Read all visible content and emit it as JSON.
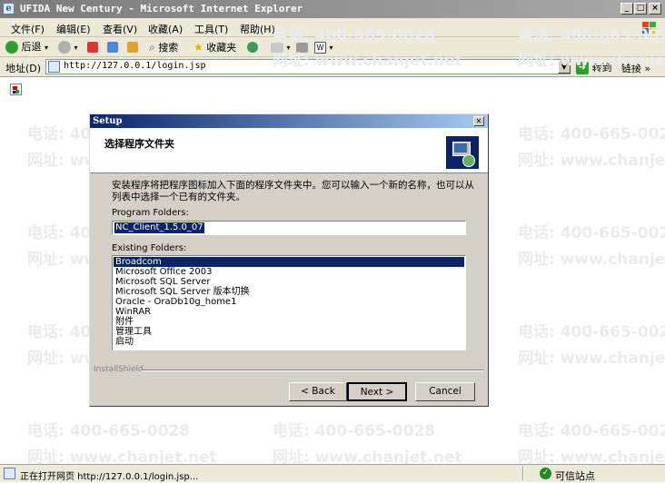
{
  "browser": {
    "title": "UFIDA New Century - Microsoft Internet Explorer",
    "menu": [
      "文件(F)",
      "编辑(E)",
      "查看(V)",
      "收藏(A)",
      "工具(T)",
      "帮助(H)"
    ],
    "toolbar": {
      "back_label": "后退",
      "search_label": "搜索",
      "favorites_label": "收藏夹"
    },
    "address": {
      "label": "地址(D)",
      "url": "http://127.0.0.1/login.jsp",
      "go_label": "转到",
      "links_label": "链接"
    }
  },
  "watermark": {
    "phone": "电话: 400-665-0028",
    "web": "网址: www.chanjet.net"
  },
  "dialog": {
    "title": "Setup",
    "heading": "选择程序文件夹",
    "description": "安装程序将把程序图标加入下面的程序文件夹中。您可以输入一个新的名称，也可以从列表中选择一个已有的文件夹。",
    "program_folders_label": "Program Folders:",
    "program_folder_value": "NC_Client_1.5.0_07",
    "existing_folders_label": "Existing Folders:",
    "existing_folders": [
      "Broadcom",
      "Microsoft Office 2003",
      "Microsoft SQL Server",
      "Microsoft SQL Server 版本切换",
      "Oracle - OraDb10g_home1",
      "WinRAR",
      "附件",
      "管理工具",
      "启动"
    ],
    "selected_folder_index": 0,
    "installshield_label": "InstallShield",
    "buttons": {
      "back": "< Back",
      "next": "Next >",
      "cancel": "Cancel"
    }
  },
  "status": {
    "text": "正在打开网页 http://127.0.0.1/login.jsp...",
    "zone": "可信站点"
  }
}
